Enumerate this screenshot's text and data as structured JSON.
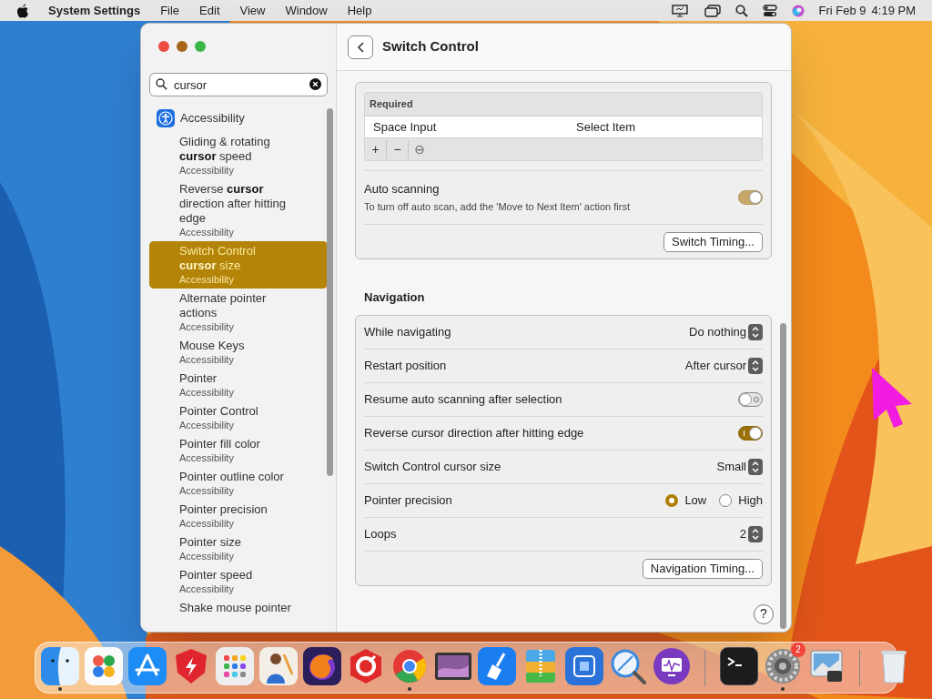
{
  "menu_bar": {
    "app_name": "System Settings",
    "menus": [
      "File",
      "Edit",
      "View",
      "Window",
      "Help"
    ],
    "date": "Fri Feb 9",
    "time": "4:19 PM"
  },
  "sidebar": {
    "search": {
      "value": "cursor"
    },
    "category": "Accessibility",
    "results": [
      {
        "title": "Gliding & rotating **cursor** speed",
        "subtitle": "Accessibility",
        "selected": false
      },
      {
        "title": "Reverse **cursor** direction after hitting edge",
        "subtitle": "Accessibility",
        "selected": false
      },
      {
        "title": "Switch Control **cursor** size",
        "subtitle": "Accessibility",
        "selected": true
      },
      {
        "title": "Alternate pointer actions",
        "subtitle": "Accessibility",
        "selected": false
      },
      {
        "title": "Mouse Keys",
        "subtitle": "Accessibility",
        "selected": false
      },
      {
        "title": "Pointer",
        "subtitle": "Accessibility",
        "selected": false
      },
      {
        "title": "Pointer Control",
        "subtitle": "Accessibility",
        "selected": false
      },
      {
        "title": "Pointer fill color",
        "subtitle": "Accessibility",
        "selected": false
      },
      {
        "title": "Pointer outline color",
        "subtitle": "Accessibility",
        "selected": false
      },
      {
        "title": "Pointer precision",
        "subtitle": "Accessibility",
        "selected": false
      },
      {
        "title": "Pointer size",
        "subtitle": "Accessibility",
        "selected": false
      },
      {
        "title": "Pointer speed",
        "subtitle": "Accessibility",
        "selected": false
      },
      {
        "title": "Shake mouse pointer"
      }
    ]
  },
  "content": {
    "title": "Switch Control",
    "switch_table": {
      "section": "Required",
      "rows": [
        [
          "Space Input",
          "Select Item"
        ]
      ],
      "toolbar": [
        "+",
        "−",
        "⊖"
      ]
    },
    "auto_scanning": {
      "label": "Auto scanning",
      "note": "To turn off auto scan, add the 'Move to Next Item' action first",
      "on": true,
      "disabled": true
    },
    "switch_timing_button": "Switch Timing...",
    "navigation": {
      "heading": "Navigation",
      "rows": [
        {
          "kind": "popup",
          "label": "While navigating",
          "value": "Do nothing"
        },
        {
          "kind": "popup",
          "label": "Restart position",
          "value": "After cursor"
        },
        {
          "kind": "toggle",
          "label": "Resume auto scanning after selection",
          "on": false
        },
        {
          "kind": "toggle",
          "label": "Reverse cursor direction after hitting edge",
          "on": true
        },
        {
          "kind": "popup",
          "label": "Switch Control cursor size",
          "value": "Small"
        },
        {
          "kind": "radio",
          "label": "Pointer precision",
          "options": [
            {
              "label": "Low",
              "selected": true
            },
            {
              "label": "High",
              "selected": false
            }
          ]
        },
        {
          "kind": "popup",
          "label": "Loops",
          "value": "2"
        }
      ],
      "button": "Navigation Timing..."
    },
    "help": "?"
  },
  "dock": {
    "items": [
      {
        "running": true
      },
      {
        "running": false
      },
      {
        "running": false
      },
      {
        "running": false
      },
      {
        "running": false
      },
      {
        "running": false
      },
      {
        "running": false
      },
      {
        "running": false
      },
      {
        "running": true
      },
      {
        "running": false
      },
      {
        "running": false
      },
      {
        "running": false
      },
      {
        "running": false
      },
      {
        "running": false
      },
      {
        "running": false
      },
      {
        "running": false
      },
      {
        "running": true,
        "badge": "2"
      },
      {
        "running": false
      },
      {
        "running": false
      }
    ]
  }
}
